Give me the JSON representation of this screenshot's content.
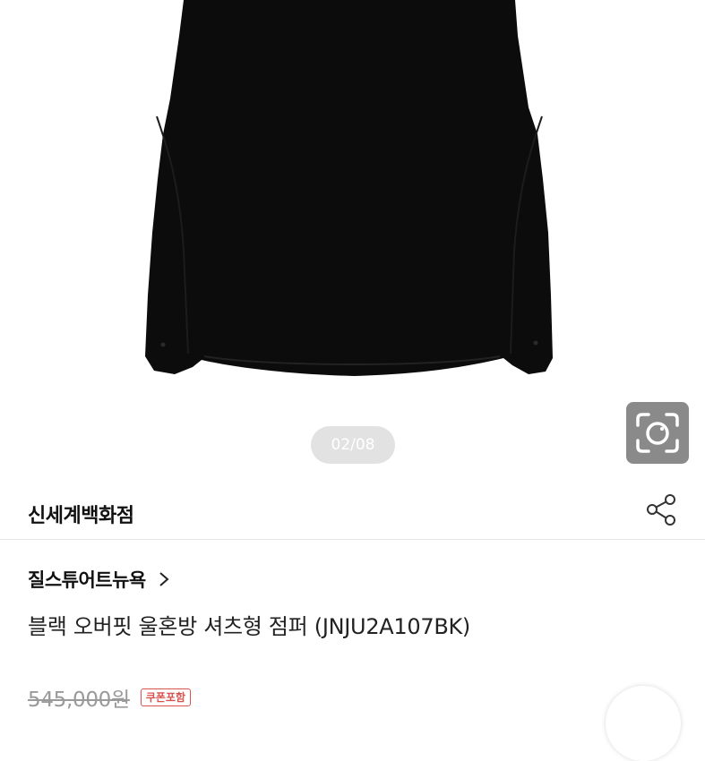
{
  "gallery": {
    "page_indicator": "02/08",
    "image_icon": "black-jacket-image",
    "lens_icon": "camera-lens-icon"
  },
  "store": {
    "name": "신세계백화점",
    "share_icon": "share-icon"
  },
  "product": {
    "brand": "질스튜어트뉴욕",
    "brand_icon": "chevron-right-icon",
    "title": "블랙 오버핏 울혼방 셔츠형 점퍼 (JNJU2A107BK)",
    "original_price": "545,000원",
    "coupon_badge": "쿠폰포함"
  },
  "colors": {
    "coupon": "#d9534f",
    "indicator_bg": "#e2e2e2",
    "lens_bg": "#8a8a8a"
  }
}
